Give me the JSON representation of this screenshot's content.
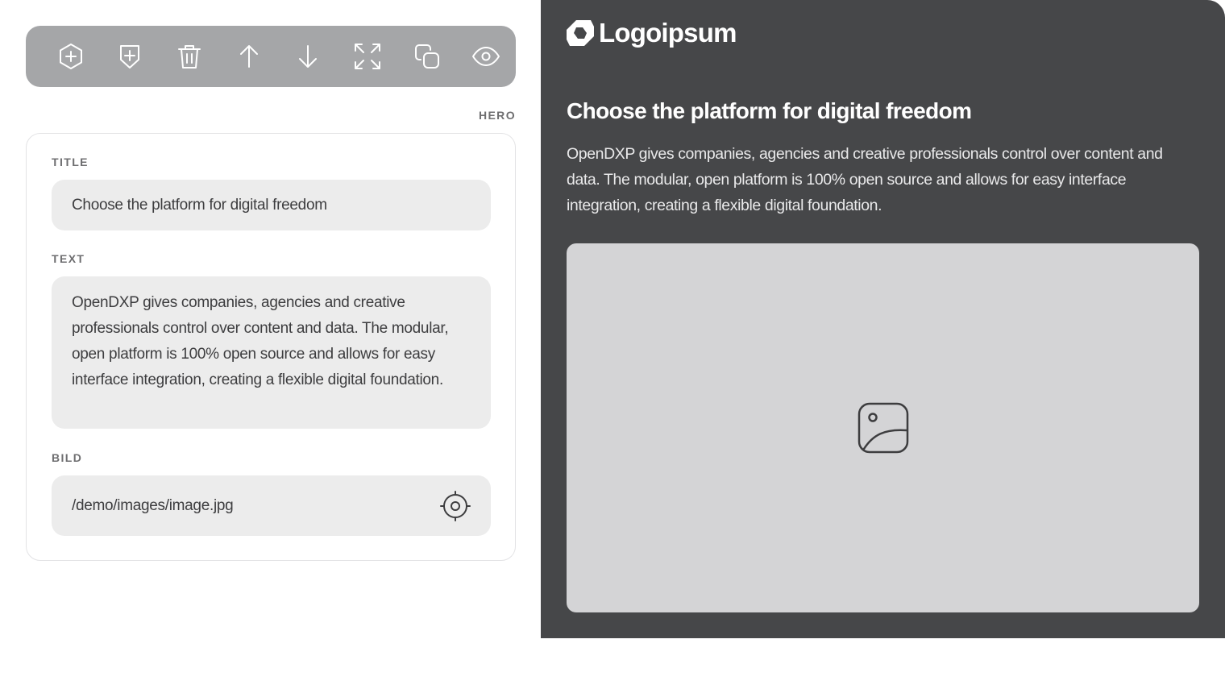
{
  "toolbar": {
    "icons": [
      "add-block-icon",
      "add-badge-icon",
      "trash-icon",
      "arrow-up-icon",
      "arrow-down-icon",
      "expand-icon",
      "duplicate-icon",
      "eye-icon"
    ],
    "background": "#a5a6a8"
  },
  "editor": {
    "section_label": "HERO",
    "fields": {
      "title": {
        "label": "TITLE",
        "value": "Choose the platform for digital freedom"
      },
      "text": {
        "label": "TEXT",
        "value": "OpenDXP gives companies, agencies and creative professionals control over content and data. The modular, open platform is 100% open source and allows for easy interface integration, creating a flexible digital foundation."
      },
      "bild": {
        "label": "BILD",
        "value": "/demo/images/image.jpg",
        "picker_icon": "target-icon"
      }
    }
  },
  "preview": {
    "logo_text": "Logoipsum",
    "title": "Choose the platform for digital freedom",
    "text": "OpenDXP gives companies, agencies and creative professionals control over content and data. The modular, open platform is 100% open source and allows for easy interface integration, creating a flexible digital foundation.",
    "image_icon": "image-icon",
    "background": "#464749"
  }
}
